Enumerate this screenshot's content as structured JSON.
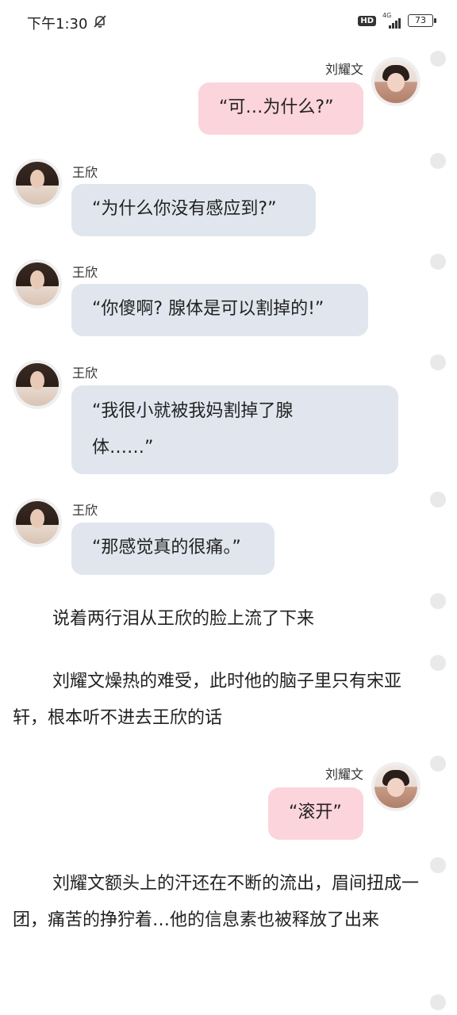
{
  "status_bar": {
    "time": "下午1:30",
    "hd_label": "HD",
    "network_label": "4G",
    "battery": "73",
    "icons": [
      "bell-off-icon",
      "hd-icon",
      "signal-icon",
      "battery-icon"
    ]
  },
  "colors": {
    "pink_bubble": "#fcd4dc",
    "gray_bubble": "#e1e6ee",
    "background": "#ffffff"
  },
  "messages": [
    {
      "speaker": "刘耀文",
      "side": "right",
      "lines": [
        "“可…为什么?”"
      ]
    },
    {
      "speaker": "王欣",
      "side": "left",
      "lines": [
        "“为什么你没有感应到?”"
      ]
    },
    {
      "speaker": "王欣",
      "side": "left",
      "lines": [
        "“你傻啊? 腺体是可以割掉的!”"
      ]
    },
    {
      "speaker": "王欣",
      "side": "left",
      "lines": [
        "“我很小就被我妈割掉了腺",
        "体……”"
      ]
    },
    {
      "speaker": "王欣",
      "side": "left",
      "lines": [
        "“那感觉真的很痛。”"
      ]
    },
    {
      "speaker": "刘耀文",
      "side": "right",
      "lines": [
        "“滚开”"
      ]
    }
  ],
  "narration": [
    "说着两行泪从王欣的脸上流了下来",
    "刘耀文燥热的难受，此时他的脑子里只有宋亚轩，根本听不进去王欣的话",
    "刘耀文额头上的汗还在不断的流出，眉间扭成一团，痛苦的挣狞着…他的信息素也被释放了出来"
  ]
}
